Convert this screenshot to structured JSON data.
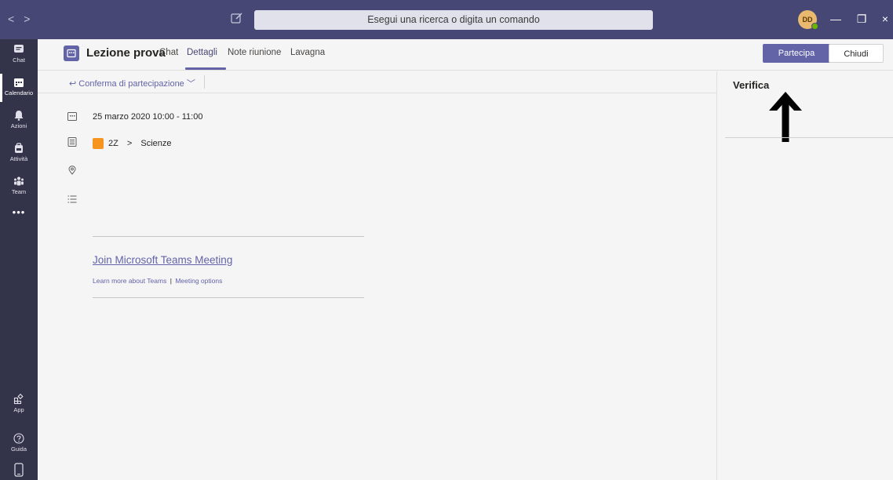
{
  "titlebar": {
    "back_glyph": "<",
    "forward_glyph": ">",
    "search_placeholder": "Esegui una ricerca o digita un comando",
    "avatar_initials": "DD",
    "minimize_glyph": "—",
    "restore_glyph": "❐",
    "close_glyph": "×"
  },
  "rail": {
    "items": [
      {
        "label": "Chat",
        "icon": "chat-icon"
      },
      {
        "label": "Calendario",
        "icon": "calendar-icon"
      },
      {
        "label": "Azioni",
        "icon": "bell-icon"
      },
      {
        "label": "Attività",
        "icon": "backpack-icon"
      },
      {
        "label": "Team",
        "icon": "team-icon"
      }
    ],
    "more": "•••",
    "bottom_items": [
      {
        "label": "App",
        "icon": "apps-icon"
      },
      {
        "label": "Guida",
        "icon": "help-icon"
      }
    ]
  },
  "header": {
    "title": "Lezione prova",
    "tabs": [
      "Chat",
      "Dettagli",
      "Note riunione",
      "Lavagna"
    ],
    "active_tab": "Dettagli",
    "join_label": "Partecipa",
    "close_label": "Chiudi"
  },
  "rsvp": {
    "label": "Conferma di partecipazione"
  },
  "details": {
    "date_time": "25 marzo 2020 10:00 - 11:00",
    "team": "2Z",
    "separator": ">",
    "channel": "Scienze",
    "join_link": "Join Microsoft Teams Meeting",
    "learn_more": "Learn more about Teams",
    "link_separator": "|",
    "meeting_options": "Meeting options"
  },
  "right_pane": {
    "title": "Verifica"
  },
  "colors": {
    "brand": "#6264a7",
    "titlebar": "#464775",
    "rail": "#33344a"
  }
}
